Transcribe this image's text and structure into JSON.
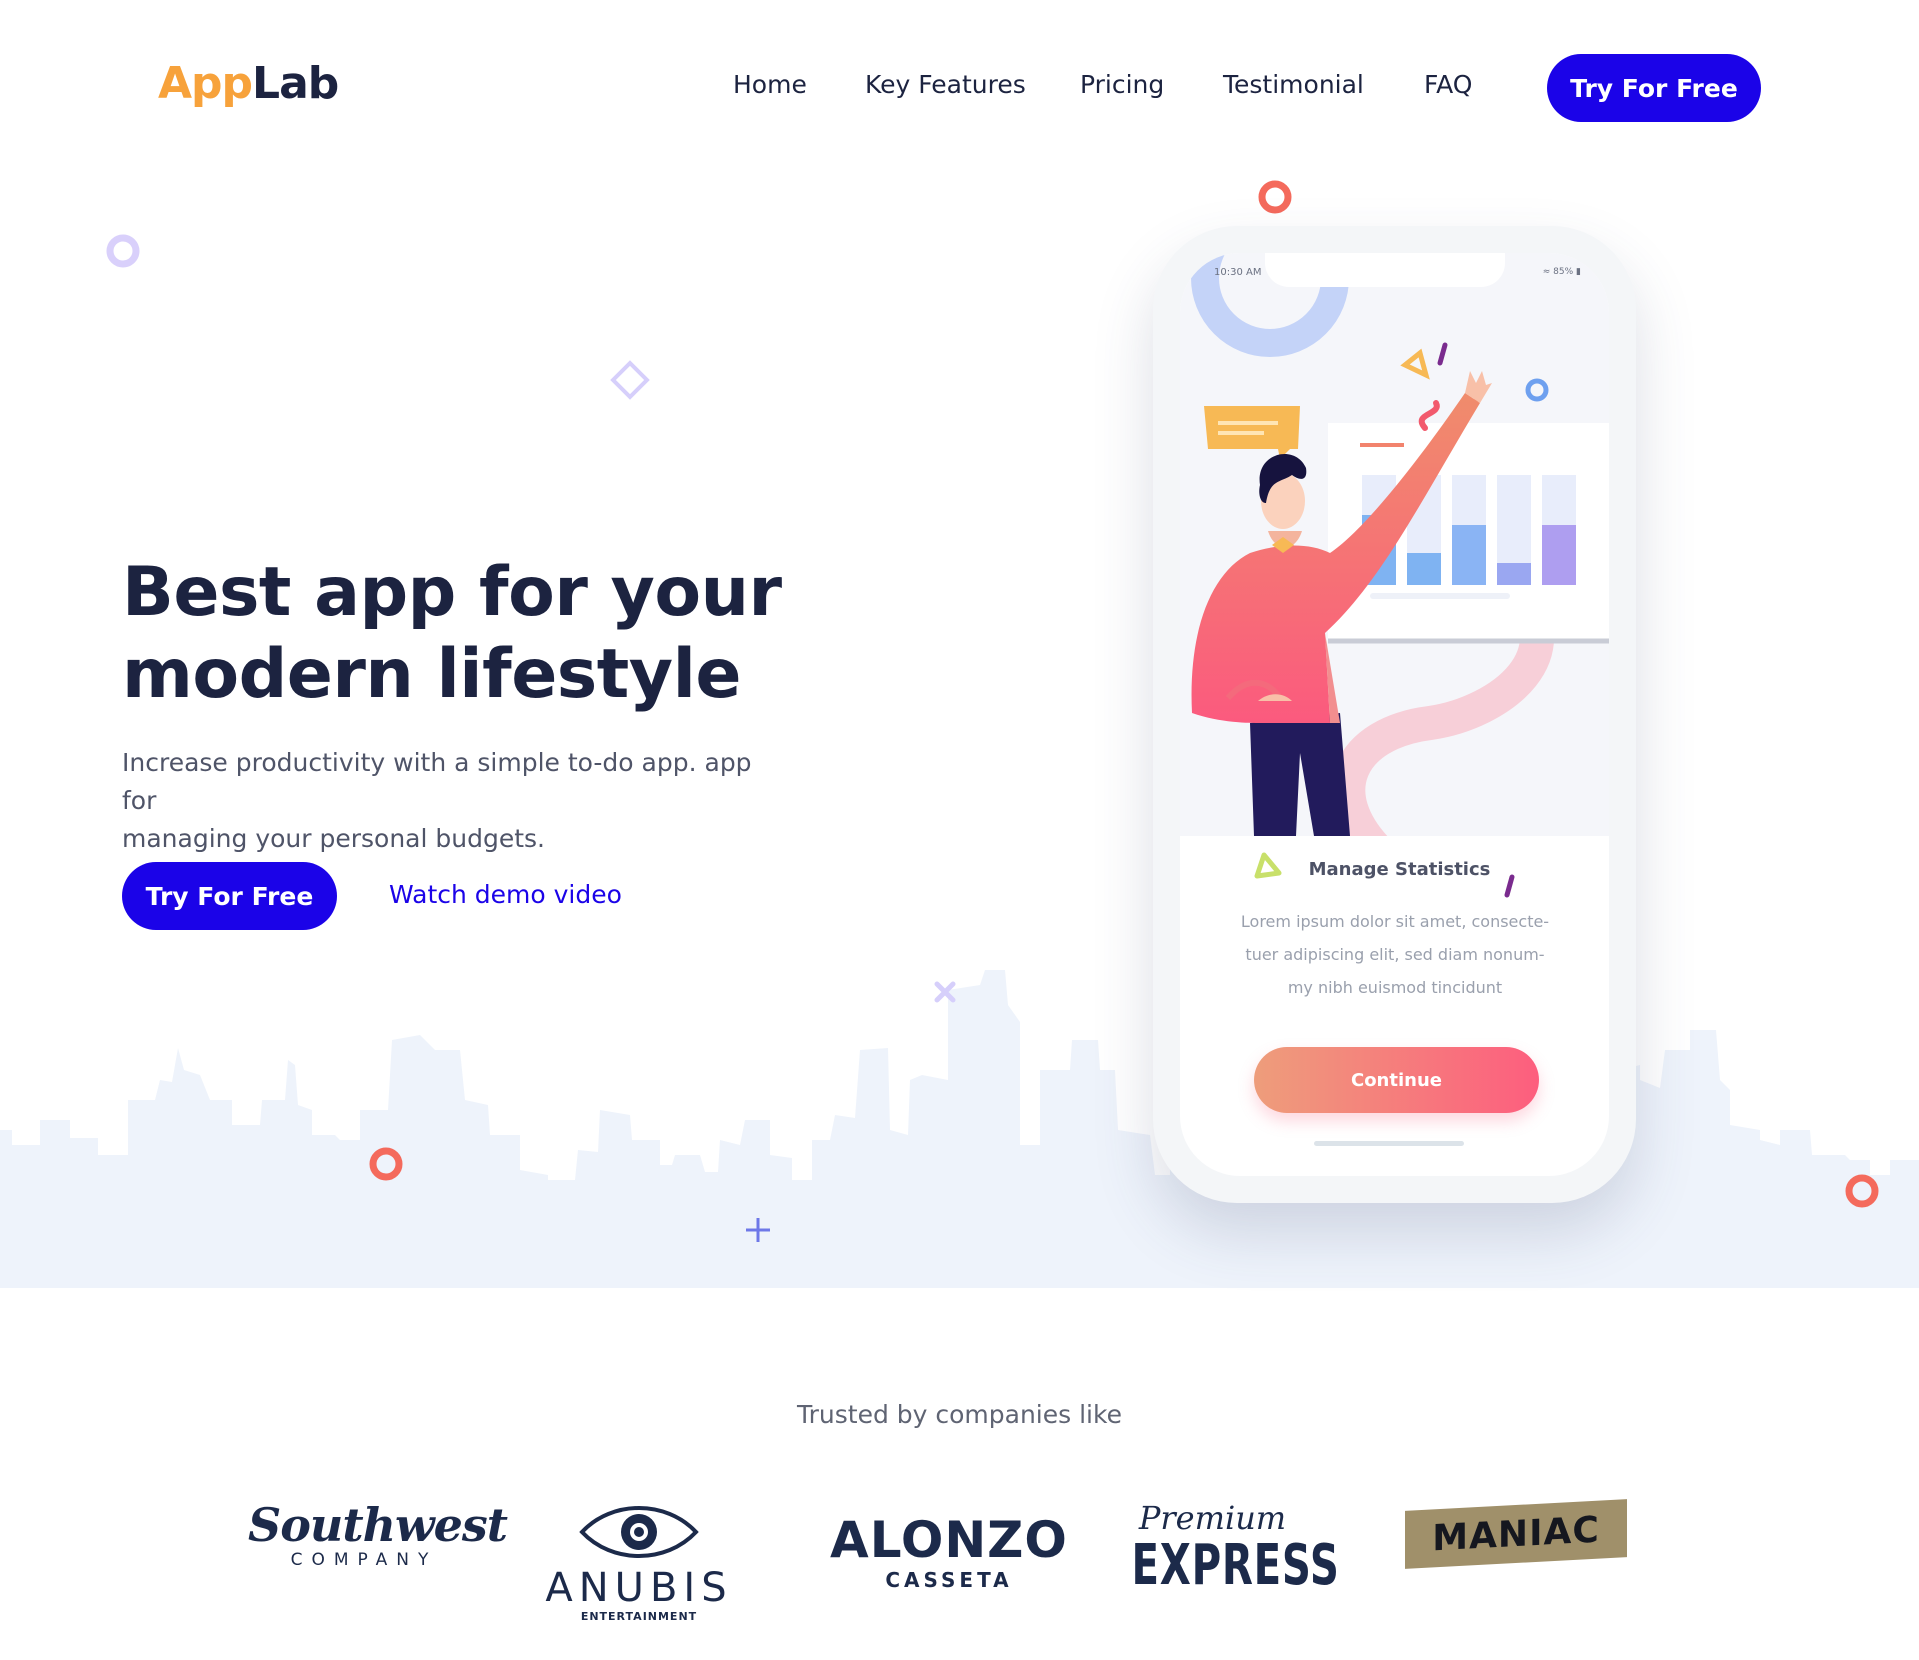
{
  "brand": {
    "logo_part1": "App",
    "logo_part2": "Lab",
    "accent_color": "#1b03e8",
    "logo_color": "#f7a23b"
  },
  "nav": {
    "items": [
      {
        "label": "Home"
      },
      {
        "label": "Key Features"
      },
      {
        "label": "Pricing"
      },
      {
        "label": "Testimonial"
      },
      {
        "label": "FAQ"
      }
    ],
    "cta_label": "Try For Free"
  },
  "hero": {
    "title_line1": "Best app for your",
    "title_line2": "modern lifestyle",
    "subtitle_line1": "Increase productivity with a simple to-do app. app for",
    "subtitle_line2": "managing your personal budgets.",
    "cta_label": "Try For Free",
    "demo_link_label": "Watch demo video"
  },
  "phone": {
    "status_time": "10:30 AM",
    "status_battery": "85%",
    "card_title": "Manage Statistics",
    "card_body_line1": "Lorem ipsum dolor sit amet, consecte-",
    "card_body_line2": "tuer adipiscing elit, sed diam nonum-",
    "card_body_line3": "my nibh euismod tincidunt",
    "continue_label": "Continue"
  },
  "trusted": {
    "heading": "Trusted by companies like",
    "companies": [
      {
        "name": "Southwest",
        "sub": "COMPANY"
      },
      {
        "name": "ANUBIS",
        "sub": "ENTERTAINMENT"
      },
      {
        "name": "ALONZO",
        "sub": "CASSETA"
      },
      {
        "name": "Premium",
        "sub": "EXPRESS"
      },
      {
        "name": "MANIAC",
        "sub": ""
      }
    ]
  }
}
